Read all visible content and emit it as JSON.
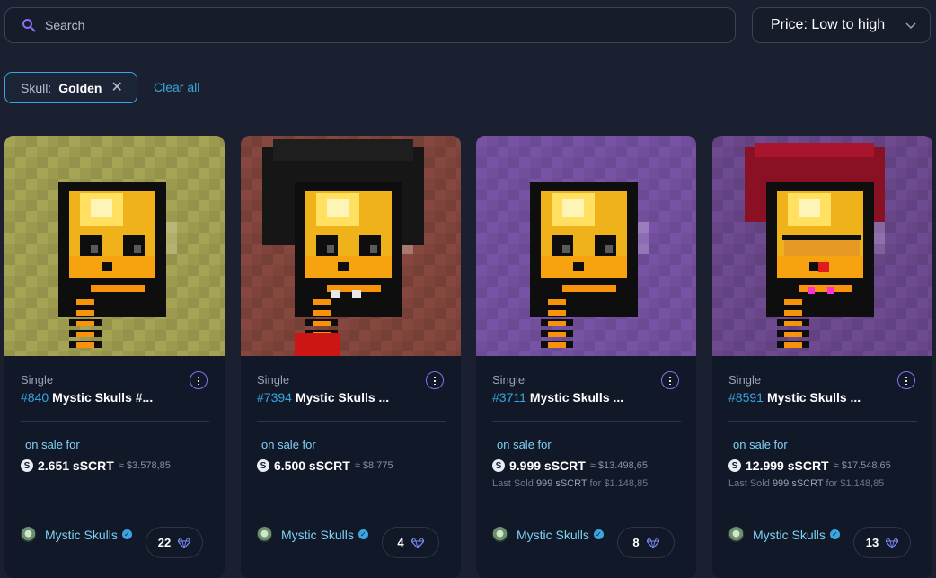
{
  "search": {
    "placeholder": "Search"
  },
  "sort": {
    "label": "Price: Low to high"
  },
  "filter": {
    "key": "Skull:",
    "value": "Golden",
    "clear_label": "Clear all"
  },
  "cards": [
    {
      "type": "Single",
      "num": "#840",
      "name": "Mystic Skulls #...",
      "on_sale": "on sale for",
      "price": "2.651 sSCRT",
      "fiat": "≈ $3.578,85",
      "last_label": "",
      "last_value": "",
      "last_fiat": "",
      "collection": "Mystic Skulls",
      "count": "22",
      "bg": "#a5a354",
      "head": "golden",
      "hair": "none"
    },
    {
      "type": "Single",
      "num": "#7394",
      "name": "Mystic Skulls ...",
      "on_sale": "on sale for",
      "price": "6.500 sSCRT",
      "fiat": "≈ $8.775",
      "last_label": "",
      "last_value": "",
      "last_fiat": "",
      "collection": "Mystic Skulls",
      "count": "4",
      "bg": "#8a4a40",
      "head": "golden",
      "hair": "afro"
    },
    {
      "type": "Single",
      "num": "#3711",
      "name": "Mystic Skulls ...",
      "on_sale": "on sale for",
      "price": "9.999 sSCRT",
      "fiat": "≈ $13.498,65",
      "last_label": "Last Sold",
      "last_value": "999 sSCRT",
      "last_fiat": "for $1.148,85",
      "collection": "Mystic Skulls",
      "count": "8",
      "bg": "#7a55a8",
      "head": "golden",
      "hair": "none"
    },
    {
      "type": "Single",
      "num": "#8591",
      "name": "Mystic Skulls ...",
      "on_sale": "on sale for",
      "price": "12.999 sSCRT",
      "fiat": "≈ $17.548,65",
      "last_label": "Last Sold",
      "last_value": "999 sSCRT",
      "last_fiat": "for $1.148,85",
      "collection": "Mystic Skulls",
      "count": "13",
      "bg": "#6e4a90",
      "head": "golden",
      "hair": "red"
    }
  ],
  "icons": {
    "search": "search-icon",
    "chevron": "chevron-down-icon",
    "close": "close-icon",
    "menu": "more-vertical-icon",
    "coin": "scrt-coin-icon",
    "verified": "verified-badge-icon",
    "gem": "diamond-icon",
    "avatar": "collection-avatar"
  },
  "colors": {
    "accent": "#3aa6e0",
    "menu_ring": "#8a6ff0",
    "bg": "#1a2030",
    "card": "#111827"
  }
}
